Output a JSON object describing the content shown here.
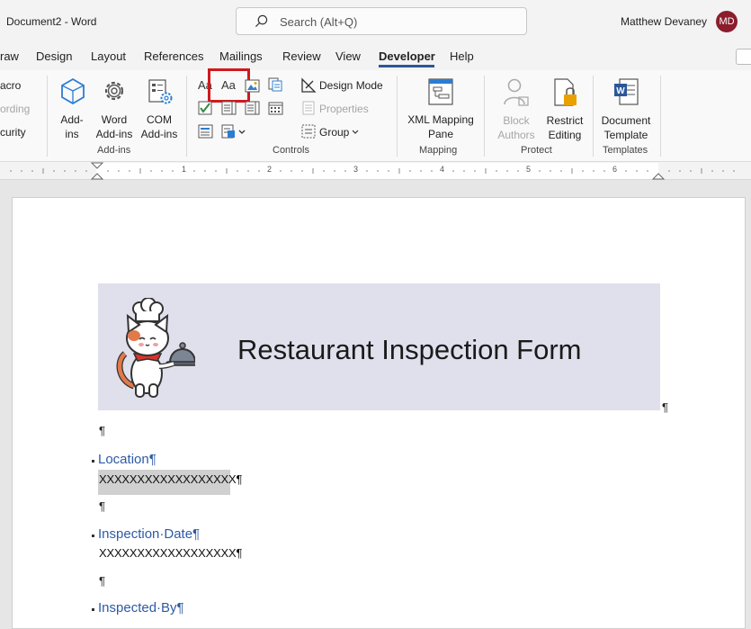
{
  "titlebar": {
    "doc_title": "Document2  -  Word",
    "search_placeholder": "Search (Alt+Q)",
    "user_name": "Matthew Devaney",
    "user_initials": "MD"
  },
  "tabs": {
    "draw": "raw",
    "design": "Design",
    "layout": "Layout",
    "references": "References",
    "mailings": "Mailings",
    "review": "Review",
    "view": "View",
    "developer": "Developer",
    "help": "Help"
  },
  "ribbon": {
    "code": {
      "macro": "acro",
      "recording": "ording",
      "security": "curity"
    },
    "addins": {
      "addins_l1": "Add-",
      "addins_l2": "ins",
      "word_l1": "Word",
      "word_l2": "Add-ins",
      "com_l1": "COM",
      "com_l2": "Add-ins",
      "label": "Add-ins"
    },
    "controls": {
      "rich_text_glyph": "Aa",
      "plain_text_glyph": "Aa",
      "design_mode": "Design Mode",
      "properties": "Properties",
      "group": "Group",
      "label": "Controls"
    },
    "mapping": {
      "xml_l1": "XML Mapping",
      "xml_l2": "Pane",
      "label": "Mapping"
    },
    "protect": {
      "block_l1": "Block",
      "block_l2": "Authors",
      "restrict_l1": "Restrict",
      "restrict_l2": "Editing",
      "label": "Protect"
    },
    "templates": {
      "doc_l1": "Document",
      "doc_l2": "Template",
      "label": "Templates"
    },
    "highlight_color": "#d0191f"
  },
  "ruler": {
    "numbers": [
      "1",
      "2",
      "3",
      "4",
      "5",
      "6"
    ]
  },
  "document": {
    "banner_title": "Restaurant Inspection Form",
    "banner_color": "#e0dfec",
    "heading_color": "#2e5aa5",
    "pilcrow": "¶",
    "fields": [
      {
        "label": "Location¶",
        "value": "XXXXXXXXXXXXXXXXXX¶"
      },
      {
        "label": "Inspection·Date¶",
        "value": "XXXXXXXXXXXXXXXXXX¶"
      },
      {
        "label": "Inspected·By¶"
      }
    ]
  }
}
